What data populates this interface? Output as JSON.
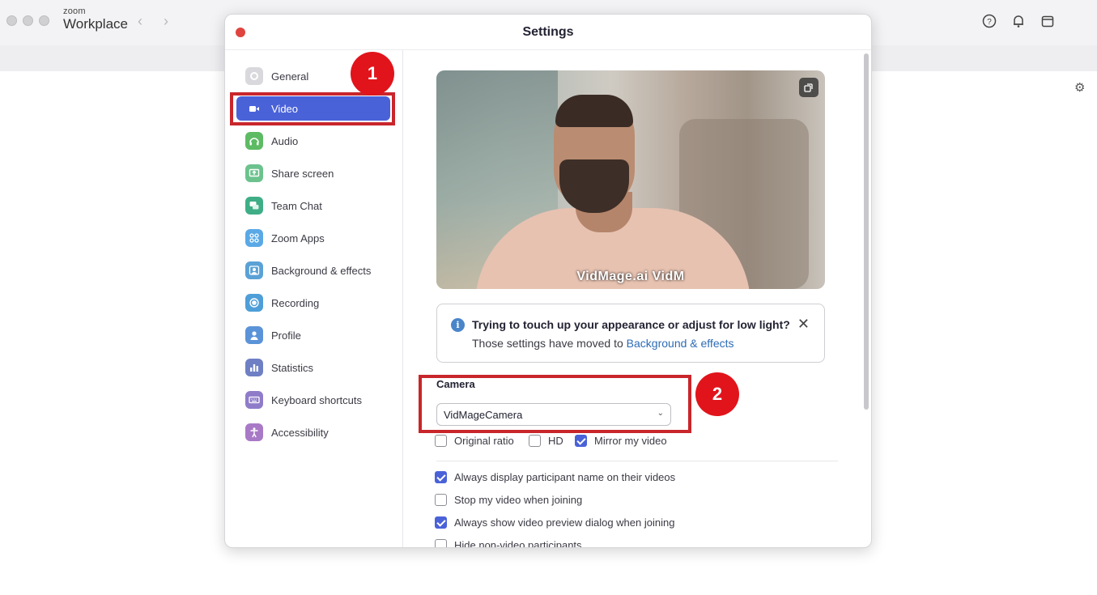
{
  "app": {
    "brand_small": "zoom",
    "brand_big": "Workplace"
  },
  "modal": {
    "title": "Settings"
  },
  "sidebar": {
    "items": [
      {
        "label": "General",
        "icon": "gear-icon",
        "color": "#c7c7cc"
      },
      {
        "label": "Video",
        "icon": "video-camera-icon",
        "color": "#4a62d8",
        "active": true
      },
      {
        "label": "Audio",
        "icon": "headphones-icon",
        "color": "#5dbb63"
      },
      {
        "label": "Share screen",
        "icon": "share-screen-icon",
        "color": "#6cc28d"
      },
      {
        "label": "Team Chat",
        "icon": "chat-bubble-icon",
        "color": "#3fae87"
      },
      {
        "label": "Zoom Apps",
        "icon": "apps-icon",
        "color": "#5aa9e6"
      },
      {
        "label": "Background & effects",
        "icon": "person-background-icon",
        "color": "#5aa1d6"
      },
      {
        "label": "Recording",
        "icon": "record-icon",
        "color": "#4e9ed8"
      },
      {
        "label": "Profile",
        "icon": "profile-icon",
        "color": "#5b93d8"
      },
      {
        "label": "Statistics",
        "icon": "bar-chart-icon",
        "color": "#6e7fc4"
      },
      {
        "label": "Keyboard shortcuts",
        "icon": "keyboard-icon",
        "color": "#8f7cc9"
      },
      {
        "label": "Accessibility",
        "icon": "accessibility-icon",
        "color": "#a879c6"
      }
    ]
  },
  "video": {
    "preview_caption": "VidMage.ai    VidM"
  },
  "notice": {
    "title": "Trying to touch up your appearance or adjust for low light?",
    "body_prefix": "Those settings have moved to ",
    "link": "Background & effects"
  },
  "camera": {
    "label": "Camera",
    "selected": "VidMageCamera"
  },
  "options_row": [
    {
      "label": "Original ratio",
      "checked": false
    },
    {
      "label": "HD",
      "checked": false
    },
    {
      "label": "Mirror my video",
      "checked": true
    }
  ],
  "options": [
    {
      "label": "Always display participant name on their videos",
      "checked": true
    },
    {
      "label": "Stop my video when joining",
      "checked": false
    },
    {
      "label": "Always show video preview dialog when joining",
      "checked": true
    },
    {
      "label": "Hide non-video participants",
      "checked": false
    }
  ],
  "annotations": {
    "step1": "1",
    "step2": "2"
  },
  "colors": {
    "accent": "#4a62d8",
    "callout": "#e1141b"
  }
}
